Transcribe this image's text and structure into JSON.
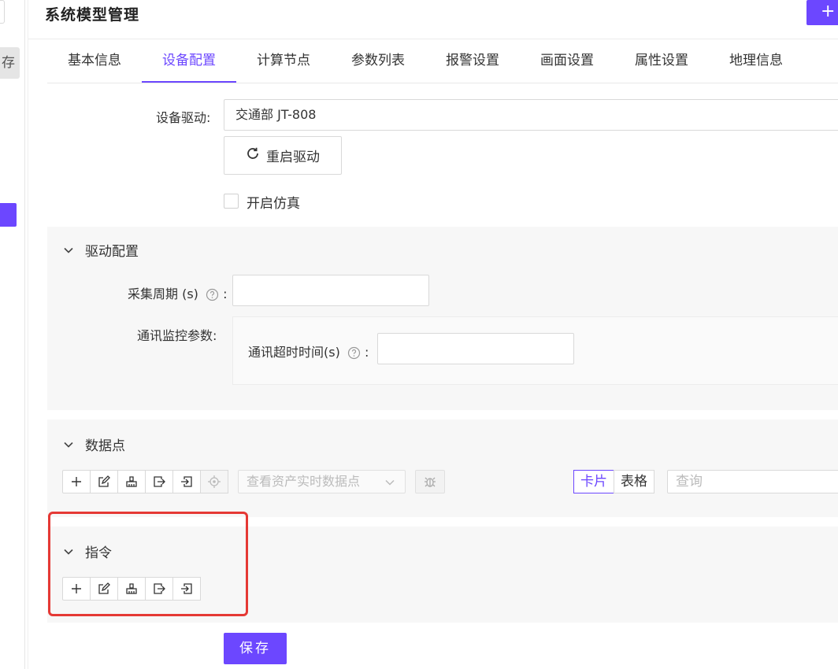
{
  "header": {
    "title": "系统模型管理",
    "add_label": "+"
  },
  "sidebar_fragment": {
    "button_char": "存"
  },
  "tabs": [
    {
      "label": "基本信息",
      "active": false
    },
    {
      "label": "设备配置",
      "active": true
    },
    {
      "label": "计算节点",
      "active": false
    },
    {
      "label": "参数列表",
      "active": false
    },
    {
      "label": "报警设置",
      "active": false
    },
    {
      "label": "画面设置",
      "active": false
    },
    {
      "label": "属性设置",
      "active": false
    },
    {
      "label": "地理信息",
      "active": false
    }
  ],
  "form": {
    "driver_label": "设备驱动:",
    "driver_value": "交通部 JT-808",
    "restart_label": "重启驱动",
    "simulate_label": "开启仿真",
    "simulate_checked": false
  },
  "driver_config": {
    "title": "驱动配置",
    "period_label": "采集周期 (s)",
    "period_value": "",
    "monitor_label": "通讯监控参数:",
    "timeout_label": "通讯超时时间(s)",
    "timeout_value": ""
  },
  "datapoints": {
    "title": "数据点",
    "select_placeholder": "查看资产实时数据点",
    "view_card": "卡片",
    "view_table": "表格",
    "query_placeholder": "查询"
  },
  "commands": {
    "title": "指令"
  },
  "footer": {
    "save_label": "保存"
  },
  "colors": {
    "accent": "#6c47ff",
    "annotation": "#e53935"
  }
}
